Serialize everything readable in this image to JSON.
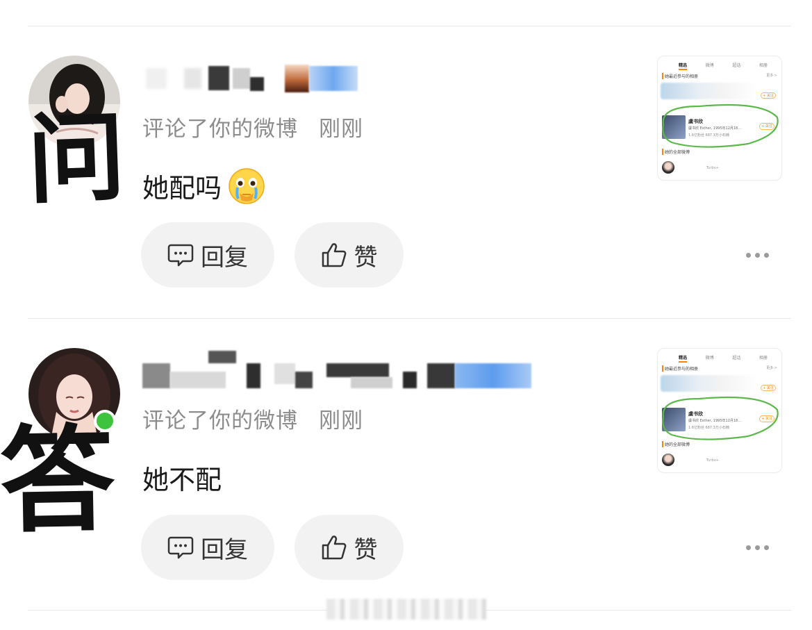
{
  "comments": [
    {
      "overlay_char": "问",
      "action": "评论了你的微博",
      "time": "刚刚",
      "text": "她配吗",
      "emoji_icon": "crying-face-emoji",
      "reply_label": "回复",
      "like_label": "赞"
    },
    {
      "overlay_char": "答",
      "action": "评论了你的微博",
      "time": "刚刚",
      "text": "她不配",
      "reply_label": "回复",
      "like_label": "赞",
      "online": true
    }
  ],
  "thumbnail": {
    "tabs": [
      "精选",
      "微博",
      "超话",
      "相册"
    ],
    "section1": "她最近参与的相册",
    "more": "更多 >",
    "follow": "+ 关注",
    "profile_name": "虞书欣",
    "profile_desc": "虞书欣 Esther, 1995年12月18...",
    "profile_stats": "1.6亿粉丝 687.3万小石楠",
    "section2": "她的全部微博",
    "mini_text": "Turbo+",
    "highlight_color": "#5cb84a"
  },
  "colors": {
    "online_dot": "#3ec33e",
    "pill_bg": "#f2f2f2",
    "meta_text": "#8c8c8c"
  }
}
